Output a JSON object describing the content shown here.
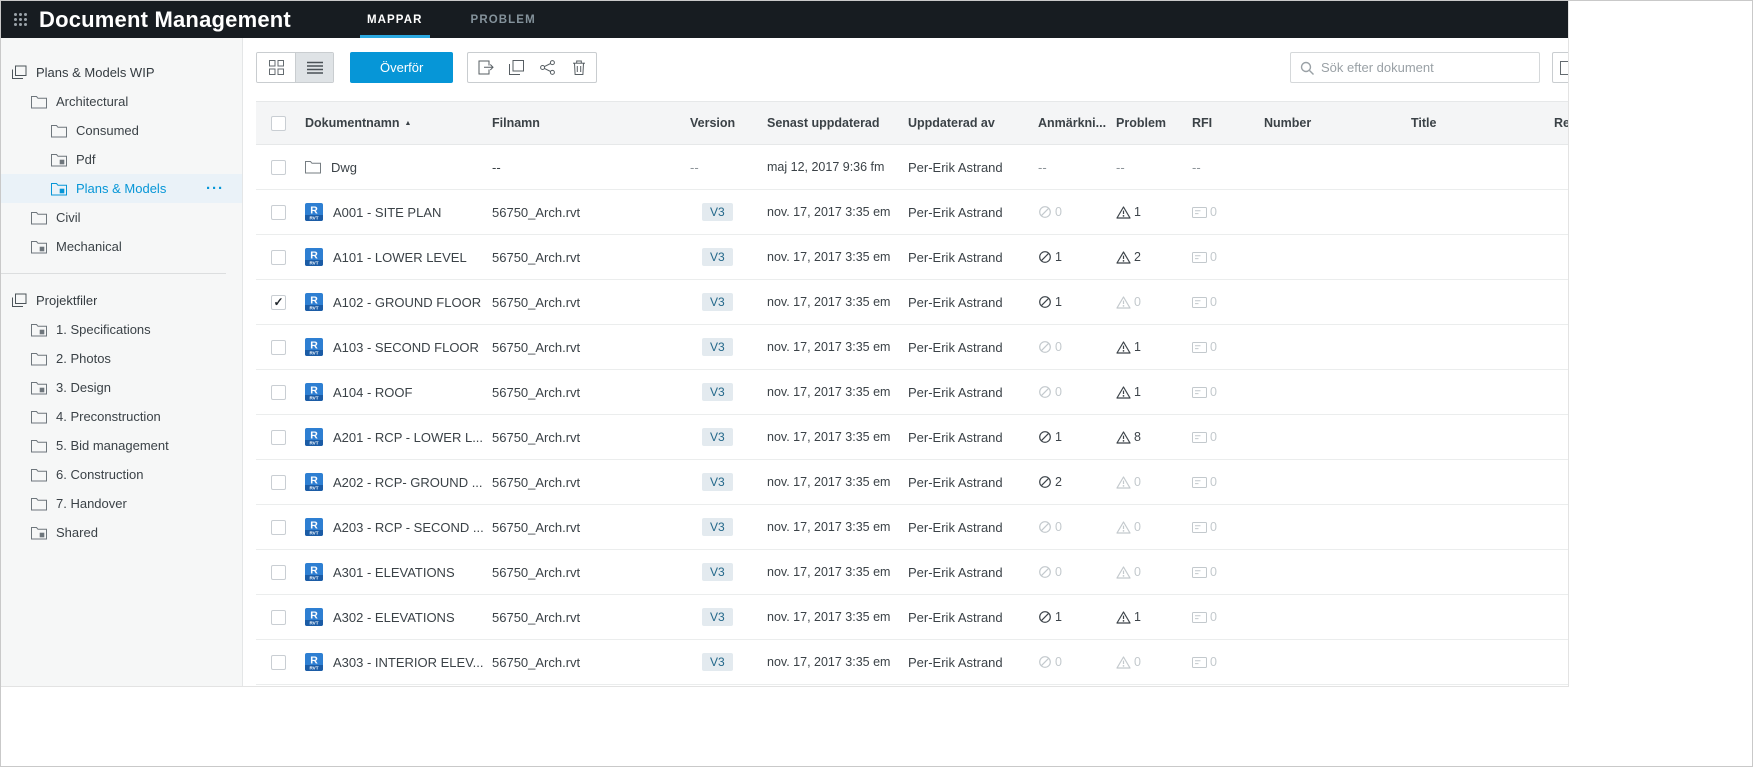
{
  "app": {
    "title": "Document Management"
  },
  "header": {
    "tabs": [
      {
        "label": "MAPPAR",
        "active": true
      },
      {
        "label": "PROBLEM",
        "active": false
      }
    ]
  },
  "sidebar": {
    "groups": [
      {
        "items": [
          {
            "label": "Plans & Models WIP",
            "level": 0,
            "icon": "stack",
            "selected": false
          },
          {
            "label": "Architectural",
            "level": 1,
            "icon": "folder",
            "selected": false
          },
          {
            "label": "Consumed",
            "level": 2,
            "icon": "folder",
            "selected": false
          },
          {
            "label": "Pdf",
            "level": 2,
            "icon": "folder-badge",
            "selected": false
          },
          {
            "label": "Plans & Models",
            "level": 2,
            "icon": "folder-badge",
            "selected": true,
            "has_menu": true
          },
          {
            "label": "Civil",
            "level": 1,
            "icon": "folder",
            "selected": false
          },
          {
            "label": "Mechanical",
            "level": 1,
            "icon": "folder-badge",
            "selected": false
          }
        ]
      },
      {
        "items": [
          {
            "label": "Projektfiler",
            "level": 0,
            "icon": "stack",
            "selected": false
          },
          {
            "label": "1. Specifications",
            "level": 1,
            "icon": "folder-badge",
            "selected": false
          },
          {
            "label": "2. Photos",
            "level": 1,
            "icon": "folder",
            "selected": false
          },
          {
            "label": "3. Design",
            "level": 1,
            "icon": "folder-badge",
            "selected": false
          },
          {
            "label": "4. Preconstruction",
            "level": 1,
            "icon": "folder",
            "selected": false
          },
          {
            "label": "5. Bid management",
            "level": 1,
            "icon": "folder",
            "selected": false
          },
          {
            "label": "6. Construction",
            "level": 1,
            "icon": "folder",
            "selected": false
          },
          {
            "label": "7. Handover",
            "level": 1,
            "icon": "folder",
            "selected": false
          },
          {
            "label": "Shared",
            "level": 1,
            "icon": "folder-badge",
            "selected": false
          }
        ]
      }
    ]
  },
  "toolbar": {
    "upload_label": "Överför",
    "search_placeholder": "Sök efter dokument",
    "view_toggle": [
      "grid-view",
      "list-view"
    ],
    "active_view": "list-view",
    "action_icons": [
      "export",
      "copy",
      "share",
      "delete"
    ]
  },
  "table": {
    "columns": [
      "Dokumentnamn",
      "Filnamn",
      "Version",
      "Senast uppdaterad",
      "Uppdaterad av",
      "Anmärkni...",
      "Problem",
      "RFI",
      "Number",
      "Title",
      "Re"
    ],
    "sort_column": "Dokumentnamn",
    "sort_direction": "asc",
    "rows": [
      {
        "type": "folder",
        "checked": false,
        "name": "Dwg",
        "filename": "--",
        "version": "--",
        "updated": "maj 12, 2017 9:36 fm",
        "updated_by": "Per-Erik Astrand",
        "markups": "--",
        "issues": "--",
        "rfi": "--"
      },
      {
        "type": "revit",
        "checked": false,
        "name": "A001 - SITE PLAN",
        "filename": "56750_Arch.rvt",
        "version": "V3",
        "updated": "nov. 17, 2017 3:35 em",
        "updated_by": "Per-Erik Astrand",
        "markups": 0,
        "issues": 1,
        "rfi": 0
      },
      {
        "type": "revit",
        "checked": false,
        "name": "A101 - LOWER LEVEL",
        "filename": "56750_Arch.rvt",
        "version": "V3",
        "updated": "nov. 17, 2017 3:35 em",
        "updated_by": "Per-Erik Astrand",
        "markups": 1,
        "issues": 2,
        "rfi": 0
      },
      {
        "type": "revit",
        "checked": true,
        "name": "A102 - GROUND FLOOR",
        "filename": "56750_Arch.rvt",
        "version": "V3",
        "updated": "nov. 17, 2017 3:35 em",
        "updated_by": "Per-Erik Astrand",
        "markups": 1,
        "issues": 0,
        "rfi": 0
      },
      {
        "type": "revit",
        "checked": false,
        "name": "A103 - SECOND FLOOR",
        "filename": "56750_Arch.rvt",
        "version": "V3",
        "updated": "nov. 17, 2017 3:35 em",
        "updated_by": "Per-Erik Astrand",
        "markups": 0,
        "issues": 1,
        "rfi": 0
      },
      {
        "type": "revit",
        "checked": false,
        "name": "A104 - ROOF",
        "filename": "56750_Arch.rvt",
        "version": "V3",
        "updated": "nov. 17, 2017 3:35 em",
        "updated_by": "Per-Erik Astrand",
        "markups": 0,
        "issues": 1,
        "rfi": 0
      },
      {
        "type": "revit",
        "checked": false,
        "name": "A201 - RCP - LOWER L...",
        "filename": "56750_Arch.rvt",
        "version": "V3",
        "updated": "nov. 17, 2017 3:35 em",
        "updated_by": "Per-Erik Astrand",
        "markups": 1,
        "issues": 8,
        "rfi": 0
      },
      {
        "type": "revit",
        "checked": false,
        "name": "A202 - RCP- GROUND ...",
        "filename": "56750_Arch.rvt",
        "version": "V3",
        "updated": "nov. 17, 2017 3:35 em",
        "updated_by": "Per-Erik Astrand",
        "markups": 2,
        "issues": 0,
        "rfi": 0
      },
      {
        "type": "revit",
        "checked": false,
        "name": "A203 - RCP - SECOND ...",
        "filename": "56750_Arch.rvt",
        "version": "V3",
        "updated": "nov. 17, 2017 3:35 em",
        "updated_by": "Per-Erik Astrand",
        "markups": 0,
        "issues": 0,
        "rfi": 0
      },
      {
        "type": "revit",
        "checked": false,
        "name": "A301 - ELEVATIONS",
        "filename": "56750_Arch.rvt",
        "version": "V3",
        "updated": "nov. 17, 2017 3:35 em",
        "updated_by": "Per-Erik Astrand",
        "markups": 0,
        "issues": 0,
        "rfi": 0
      },
      {
        "type": "revit",
        "checked": false,
        "name": "A302 - ELEVATIONS",
        "filename": "56750_Arch.rvt",
        "version": "V3",
        "updated": "nov. 17, 2017 3:35 em",
        "updated_by": "Per-Erik Astrand",
        "markups": 1,
        "issues": 1,
        "rfi": 0
      },
      {
        "type": "revit",
        "checked": false,
        "name": "A303 - INTERIOR ELEV...",
        "filename": "56750_Arch.rvt",
        "version": "V3",
        "updated": "nov. 17, 2017 3:35 em",
        "updated_by": "Per-Erik Astrand",
        "markups": 0,
        "issues": 0,
        "rfi": 0
      }
    ]
  },
  "colors": {
    "accent": "#0696d7",
    "topbar_bg": "#171c21",
    "tab_underline": "#2ba8e0",
    "muted_count": "#c3c9cd"
  }
}
